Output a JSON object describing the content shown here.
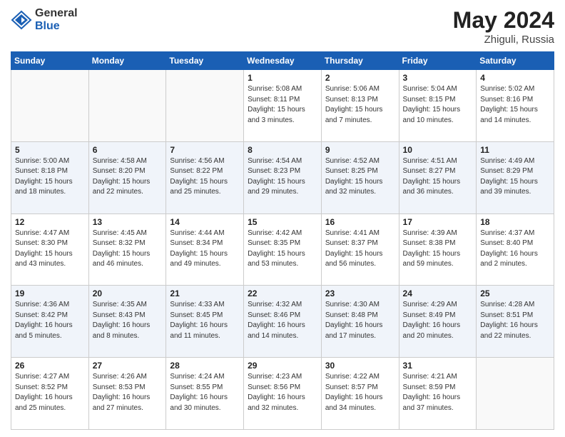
{
  "logo": {
    "general": "General",
    "blue": "Blue"
  },
  "title": {
    "month": "May 2024",
    "location": "Zhiguli, Russia"
  },
  "days_of_week": [
    "Sunday",
    "Monday",
    "Tuesday",
    "Wednesday",
    "Thursday",
    "Friday",
    "Saturday"
  ],
  "weeks": [
    [
      {
        "day": "",
        "info": ""
      },
      {
        "day": "",
        "info": ""
      },
      {
        "day": "",
        "info": ""
      },
      {
        "day": "1",
        "info": "Sunrise: 5:08 AM\nSunset: 8:11 PM\nDaylight: 15 hours\nand 3 minutes."
      },
      {
        "day": "2",
        "info": "Sunrise: 5:06 AM\nSunset: 8:13 PM\nDaylight: 15 hours\nand 7 minutes."
      },
      {
        "day": "3",
        "info": "Sunrise: 5:04 AM\nSunset: 8:15 PM\nDaylight: 15 hours\nand 10 minutes."
      },
      {
        "day": "4",
        "info": "Sunrise: 5:02 AM\nSunset: 8:16 PM\nDaylight: 15 hours\nand 14 minutes."
      }
    ],
    [
      {
        "day": "5",
        "info": "Sunrise: 5:00 AM\nSunset: 8:18 PM\nDaylight: 15 hours\nand 18 minutes."
      },
      {
        "day": "6",
        "info": "Sunrise: 4:58 AM\nSunset: 8:20 PM\nDaylight: 15 hours\nand 22 minutes."
      },
      {
        "day": "7",
        "info": "Sunrise: 4:56 AM\nSunset: 8:22 PM\nDaylight: 15 hours\nand 25 minutes."
      },
      {
        "day": "8",
        "info": "Sunrise: 4:54 AM\nSunset: 8:23 PM\nDaylight: 15 hours\nand 29 minutes."
      },
      {
        "day": "9",
        "info": "Sunrise: 4:52 AM\nSunset: 8:25 PM\nDaylight: 15 hours\nand 32 minutes."
      },
      {
        "day": "10",
        "info": "Sunrise: 4:51 AM\nSunset: 8:27 PM\nDaylight: 15 hours\nand 36 minutes."
      },
      {
        "day": "11",
        "info": "Sunrise: 4:49 AM\nSunset: 8:29 PM\nDaylight: 15 hours\nand 39 minutes."
      }
    ],
    [
      {
        "day": "12",
        "info": "Sunrise: 4:47 AM\nSunset: 8:30 PM\nDaylight: 15 hours\nand 43 minutes."
      },
      {
        "day": "13",
        "info": "Sunrise: 4:45 AM\nSunset: 8:32 PM\nDaylight: 15 hours\nand 46 minutes."
      },
      {
        "day": "14",
        "info": "Sunrise: 4:44 AM\nSunset: 8:34 PM\nDaylight: 15 hours\nand 49 minutes."
      },
      {
        "day": "15",
        "info": "Sunrise: 4:42 AM\nSunset: 8:35 PM\nDaylight: 15 hours\nand 53 minutes."
      },
      {
        "day": "16",
        "info": "Sunrise: 4:41 AM\nSunset: 8:37 PM\nDaylight: 15 hours\nand 56 minutes."
      },
      {
        "day": "17",
        "info": "Sunrise: 4:39 AM\nSunset: 8:38 PM\nDaylight: 15 hours\nand 59 minutes."
      },
      {
        "day": "18",
        "info": "Sunrise: 4:37 AM\nSunset: 8:40 PM\nDaylight: 16 hours\nand 2 minutes."
      }
    ],
    [
      {
        "day": "19",
        "info": "Sunrise: 4:36 AM\nSunset: 8:42 PM\nDaylight: 16 hours\nand 5 minutes."
      },
      {
        "day": "20",
        "info": "Sunrise: 4:35 AM\nSunset: 8:43 PM\nDaylight: 16 hours\nand 8 minutes."
      },
      {
        "day": "21",
        "info": "Sunrise: 4:33 AM\nSunset: 8:45 PM\nDaylight: 16 hours\nand 11 minutes."
      },
      {
        "day": "22",
        "info": "Sunrise: 4:32 AM\nSunset: 8:46 PM\nDaylight: 16 hours\nand 14 minutes."
      },
      {
        "day": "23",
        "info": "Sunrise: 4:30 AM\nSunset: 8:48 PM\nDaylight: 16 hours\nand 17 minutes."
      },
      {
        "day": "24",
        "info": "Sunrise: 4:29 AM\nSunset: 8:49 PM\nDaylight: 16 hours\nand 20 minutes."
      },
      {
        "day": "25",
        "info": "Sunrise: 4:28 AM\nSunset: 8:51 PM\nDaylight: 16 hours\nand 22 minutes."
      }
    ],
    [
      {
        "day": "26",
        "info": "Sunrise: 4:27 AM\nSunset: 8:52 PM\nDaylight: 16 hours\nand 25 minutes."
      },
      {
        "day": "27",
        "info": "Sunrise: 4:26 AM\nSunset: 8:53 PM\nDaylight: 16 hours\nand 27 minutes."
      },
      {
        "day": "28",
        "info": "Sunrise: 4:24 AM\nSunset: 8:55 PM\nDaylight: 16 hours\nand 30 minutes."
      },
      {
        "day": "29",
        "info": "Sunrise: 4:23 AM\nSunset: 8:56 PM\nDaylight: 16 hours\nand 32 minutes."
      },
      {
        "day": "30",
        "info": "Sunrise: 4:22 AM\nSunset: 8:57 PM\nDaylight: 16 hours\nand 34 minutes."
      },
      {
        "day": "31",
        "info": "Sunrise: 4:21 AM\nSunset: 8:59 PM\nDaylight: 16 hours\nand 37 minutes."
      },
      {
        "day": "",
        "info": ""
      }
    ]
  ]
}
